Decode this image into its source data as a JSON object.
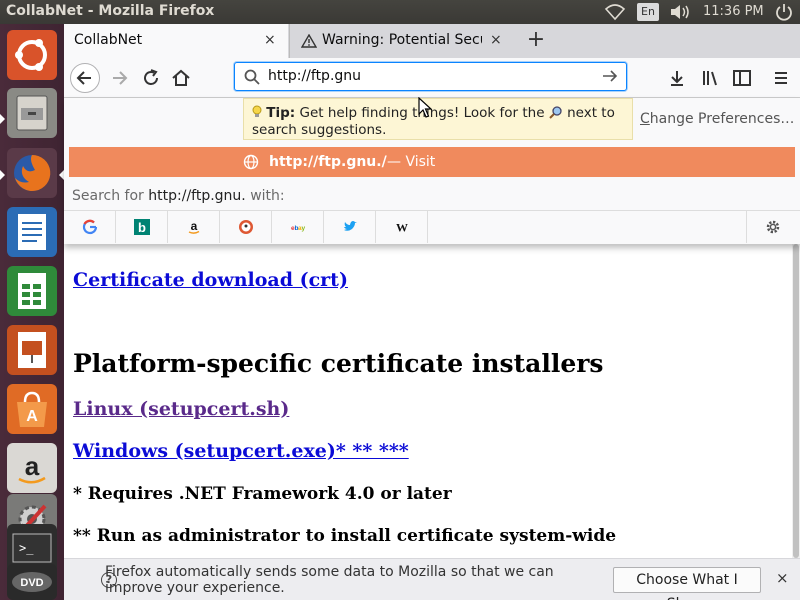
{
  "topbar": {
    "title": "CollabNet - Mozilla Firefox",
    "lang": "En",
    "clock": "11:36 PM"
  },
  "launcher": {
    "items": [
      "ubuntu-dash",
      "files",
      "firefox",
      "libreoffice-writer",
      "libreoffice-calc",
      "libreoffice-impress",
      "ubuntu-software",
      "amazon",
      "system-settings",
      "terminal",
      "dvd"
    ]
  },
  "tabs": [
    {
      "label": "CollabNet",
      "close": "×"
    },
    {
      "label": "Warning: Potential Secu",
      "close": "×"
    }
  ],
  "newtab": "+",
  "navbar": {
    "url_value": "http://ftp.gnu"
  },
  "dropdown": {
    "tip_bold": "Tip:",
    "tip_text_1": "Get help finding things! Look for the",
    "tip_text_2": "next to",
    "tip_text_3": "search suggestions.",
    "change_pref_first": "C",
    "change_pref_rest": "hange Preferences…",
    "suggest_url": "http://ftp.gnu./",
    "suggest_visit": "— Visit",
    "search_for_prefix": "Search for",
    "search_for_query": "http://ftp.gnu.",
    "search_for_suffix": "with:",
    "engines": [
      "google",
      "bing",
      "amazon",
      "duckduckgo",
      "ebay",
      "twitter",
      "wikipedia"
    ]
  },
  "content": {
    "cert_link": "Certificate download (crt)",
    "heading": "Platform-specific certificate installers",
    "linux_link": "Linux (setupcert.sh)",
    "windows_link": "Windows (setupcert.exe)* ** ***",
    "note1": "* Requires .NET Framework 4.0 or later",
    "note2": "** Run as administrator to install certificate system-wide"
  },
  "notification": {
    "info_glyph": "?",
    "message": "Firefox automatically sends some data to Mozilla so that we can improve your experience.",
    "button": "Choose What I Share",
    "close": "×"
  },
  "colors": {
    "suggest_bg": "#f08a5d",
    "link": "#0b0bd6",
    "visited_link": "#5a2a8a",
    "launcher_bg": "#4a2b3a"
  }
}
